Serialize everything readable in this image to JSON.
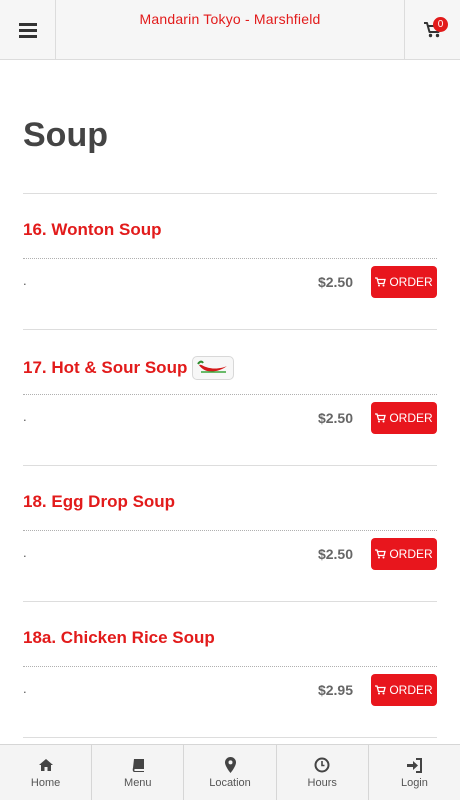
{
  "header": {
    "title": "Mandarin Tokyo - Marshfield",
    "cart_count": "0"
  },
  "section": {
    "title": "Soup"
  },
  "items": [
    {
      "name": "16. Wonton Soup",
      "description": ".",
      "price": "$2.50",
      "order_label": "ORDER",
      "spicy": false
    },
    {
      "name": "17. Hot & Sour Soup",
      "description": ".",
      "price": "$2.50",
      "order_label": "ORDER",
      "spicy": true
    },
    {
      "name": "18. Egg Drop Soup",
      "description": ".",
      "price": "$2.50",
      "order_label": "ORDER",
      "spicy": false
    },
    {
      "name": "18a. Chicken Rice Soup",
      "description": ".",
      "price": "$2.95",
      "order_label": "ORDER",
      "spicy": false
    }
  ],
  "nav": [
    {
      "label": "Home",
      "icon": "home-icon"
    },
    {
      "label": "Menu",
      "icon": "book-icon"
    },
    {
      "label": "Location",
      "icon": "map-marker-icon"
    },
    {
      "label": "Hours",
      "icon": "clock-icon"
    },
    {
      "label": "Login",
      "icon": "sign-in-icon"
    }
  ],
  "colors": {
    "brand_red": "#e21b1b",
    "order_button": "#e8161d",
    "heading": "#444444"
  }
}
